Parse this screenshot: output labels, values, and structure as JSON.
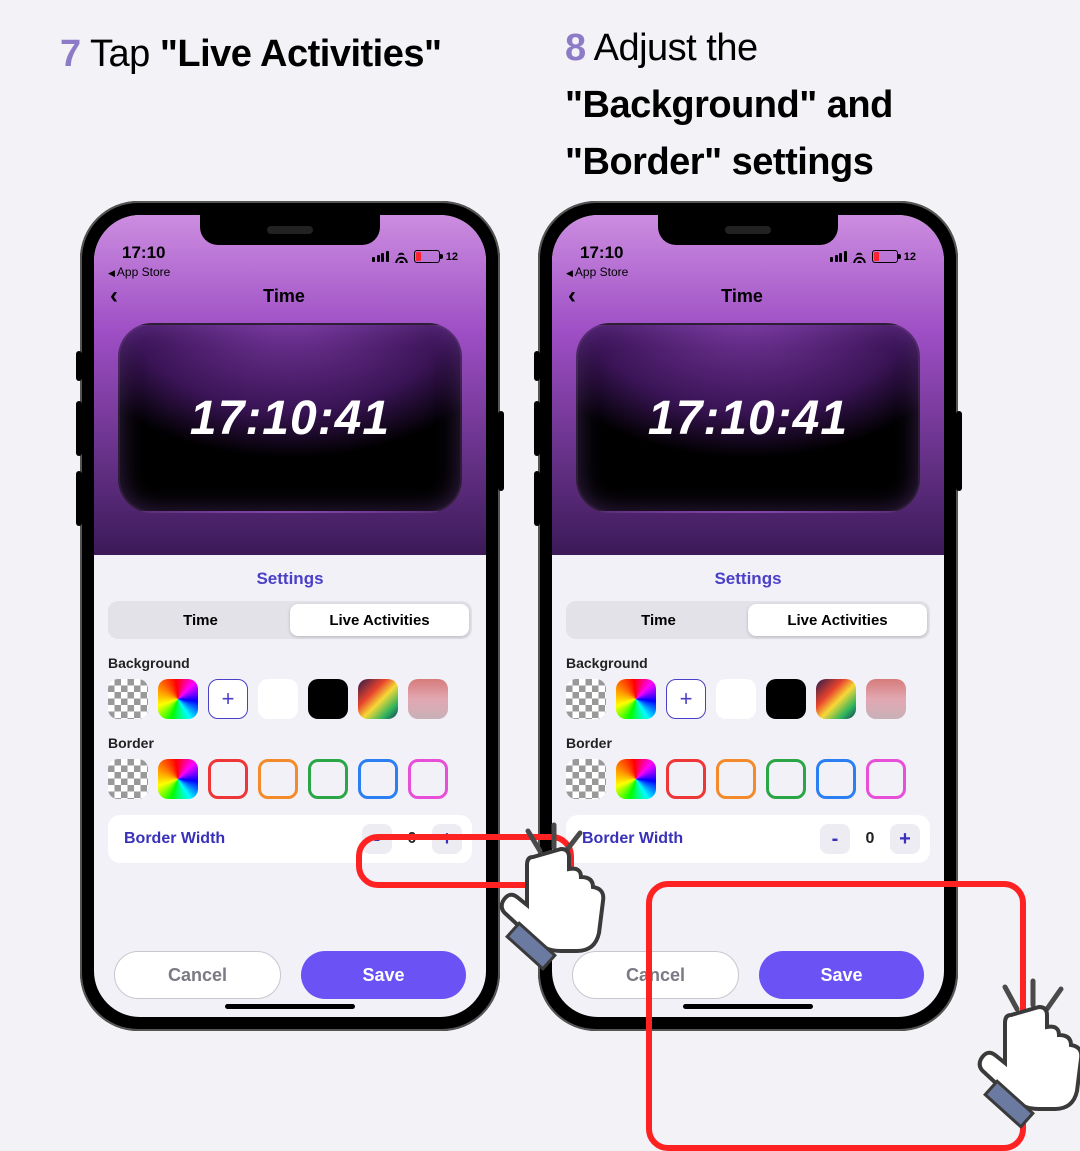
{
  "captions": {
    "step7": {
      "num": "7",
      "text_pre": "Tap ",
      "text_strong": "\"Live Activities\""
    },
    "step8": {
      "num": "8",
      "line1_pre": "Adjust the",
      "line2": "\"Background\" and",
      "line3": "\"Border\" settings"
    }
  },
  "statusbar": {
    "time": "17:10",
    "back_app": "App Store",
    "battery": "12"
  },
  "nav": {
    "title": "Time"
  },
  "clock": {
    "time": "17:10:41"
  },
  "settings": {
    "heading": "Settings",
    "tabs": {
      "time": "Time",
      "live": "Live Activities"
    },
    "background_label": "Background",
    "border_label": "Border",
    "add_symbol": "+",
    "border_width": {
      "label": "Border Width",
      "minus": "-",
      "value": "0",
      "plus": "+"
    }
  },
  "footer": {
    "cancel": "Cancel",
    "save": "Save"
  }
}
